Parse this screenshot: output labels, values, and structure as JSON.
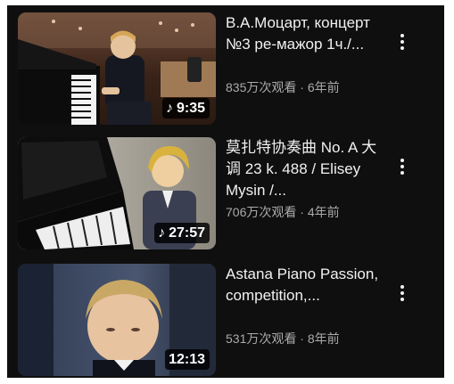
{
  "videos": [
    {
      "title": "В.А.Моцарт, концерт №3 ре-мажор 1ч./...",
      "views": "835万次观看",
      "separator": "·",
      "age": "6年前",
      "duration": "9:35",
      "music_icon": "music-note-icon",
      "thumbnail": "boy-playing-grand-piano-on-stage"
    },
    {
      "title": "莫扎特协奏曲 No. A 大调 23 k. 488 / Elisey Mysin /...",
      "views": "706万次观看",
      "separator": "·",
      "age": "4年前",
      "duration": "27:57",
      "music_icon": "music-note-icon",
      "thumbnail": "blond-boy-beside-piano-keyboard"
    },
    {
      "title": "Astana Piano Passion, competition,...",
      "views": "531万次观看",
      "separator": "·",
      "age": "8年前",
      "duration": "12:13",
      "thumbnail": "close-up-of-boy-playing"
    }
  ],
  "colors": {
    "background": "#0f0f0f",
    "title_text": "#f1f1f1",
    "meta_text": "#aaaaaa",
    "duration_badge": "#000000"
  }
}
